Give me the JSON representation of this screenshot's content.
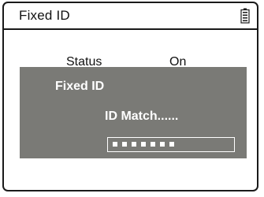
{
  "header": {
    "title": "Fixed ID",
    "battery_icon": "battery-icon"
  },
  "background_row": {
    "label": "Status",
    "value": "On"
  },
  "dialog": {
    "title": "Fixed ID",
    "message": "ID Match......",
    "progress_dots": 7
  },
  "colors": {
    "dialog_background": "#7a7a76",
    "text_light": "#ffffff",
    "frame": "#1a1a1a"
  }
}
